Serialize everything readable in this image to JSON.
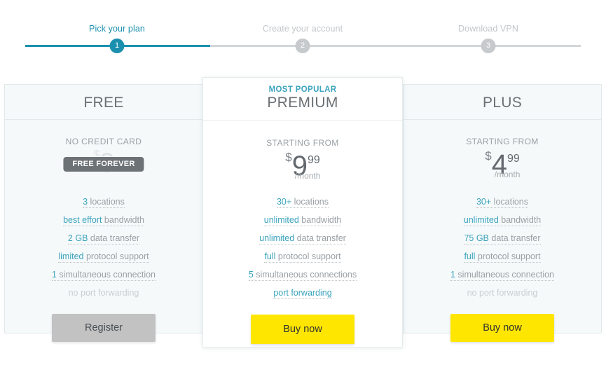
{
  "colors": {
    "accent": "#1b90ae",
    "accent_light": "#3ba3bd",
    "inactive": "#c6cacc",
    "cta_yellow": "#ffe600",
    "cta_grey": "#c2c2c2",
    "card_tint": "#f5f9fa"
  },
  "stepper": {
    "steps": [
      {
        "number": "1",
        "label": "Pick your plan",
        "state": "active"
      },
      {
        "number": "2",
        "label": "Create your account",
        "state": "inactive"
      },
      {
        "number": "3",
        "label": "Download VPN",
        "state": "inactive"
      }
    ]
  },
  "plans": [
    {
      "id": "free",
      "name": "FREE",
      "badge_label": "",
      "price_caption": "NO CREDIT CARD",
      "currency": "$",
      "amount": "0",
      "cents": "",
      "period": "",
      "forever_badge": "FREE FOREVER",
      "features": [
        {
          "highlight": "3",
          "rest": " locations",
          "enabled": true
        },
        {
          "highlight": "best effort",
          "rest": " bandwidth",
          "enabled": true
        },
        {
          "highlight": "2 GB",
          "rest": " data transfer",
          "enabled": true
        },
        {
          "highlight": "limited",
          "rest": " protocol support",
          "enabled": true
        },
        {
          "highlight": "1",
          "rest": " simultaneous connection",
          "enabled": true
        },
        {
          "highlight": "",
          "rest": "no port forwarding",
          "enabled": false
        }
      ],
      "cta": "Register"
    },
    {
      "id": "premium",
      "name": "PREMIUM",
      "badge_label": "MOST POPULAR",
      "price_caption": "STARTING FROM",
      "currency": "$",
      "amount": "9",
      "cents": "99",
      "period": "/month",
      "forever_badge": "",
      "features": [
        {
          "highlight": "30+",
          "rest": " locations",
          "enabled": true
        },
        {
          "highlight": "unlimited",
          "rest": " bandwidth",
          "enabled": true
        },
        {
          "highlight": "unlimited",
          "rest": " data transfer",
          "enabled": true
        },
        {
          "highlight": "full",
          "rest": " protocol support",
          "enabled": true
        },
        {
          "highlight": "5",
          "rest": " simultaneous connections",
          "enabled": true
        },
        {
          "highlight": "port forwarding",
          "rest": "",
          "enabled": true
        }
      ],
      "cta": "Buy now"
    },
    {
      "id": "plus",
      "name": "PLUS",
      "badge_label": "",
      "price_caption": "STARTING FROM",
      "currency": "$",
      "amount": "4",
      "cents": "99",
      "period": "/month",
      "forever_badge": "",
      "features": [
        {
          "highlight": "30+",
          "rest": " locations",
          "enabled": true
        },
        {
          "highlight": "unlimited",
          "rest": " bandwidth",
          "enabled": true
        },
        {
          "highlight": "75 GB",
          "rest": " data transfer",
          "enabled": true
        },
        {
          "highlight": "full",
          "rest": " protocol support",
          "enabled": true
        },
        {
          "highlight": "1",
          "rest": " simultaneous connection",
          "enabled": true
        },
        {
          "highlight": "",
          "rest": "no port forwarding",
          "enabled": false
        }
      ],
      "cta": "Buy now"
    }
  ]
}
